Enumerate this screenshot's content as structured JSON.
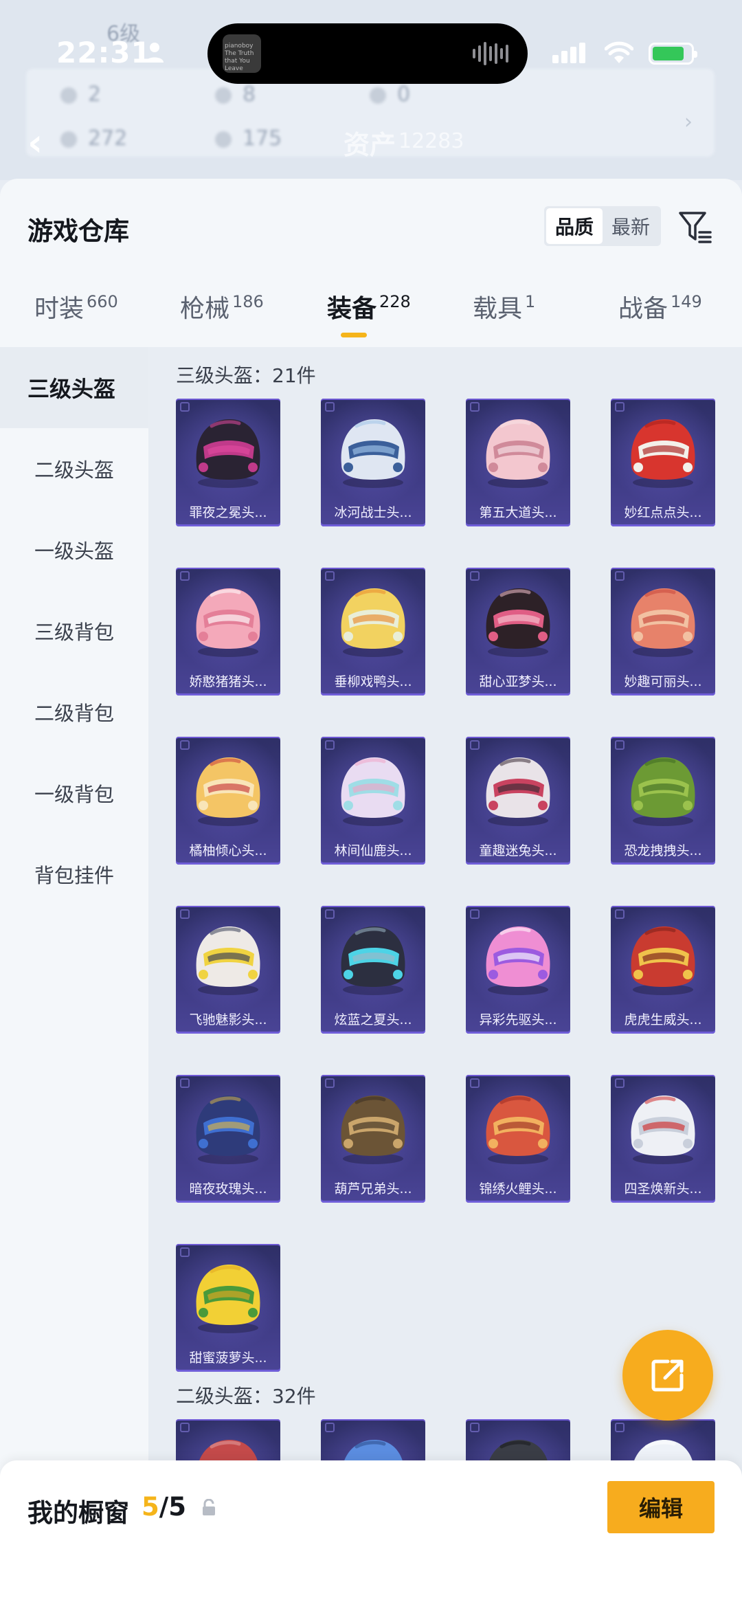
{
  "status_bar": {
    "time": "22:31",
    "island_thumb_text": "pianoboy The Truth that You Leave"
  },
  "background_header": {
    "level": "6级",
    "stats_row1": [
      "2",
      "8",
      "0"
    ],
    "stats_row2": [
      "272",
      "175"
    ],
    "asset_label": "资产",
    "asset_value": "12283"
  },
  "sheet": {
    "title": "游戏仓库",
    "sort_options": [
      "品质",
      "最新"
    ],
    "sort_selected": "品质"
  },
  "tabs": [
    {
      "label": "时装",
      "count": "660"
    },
    {
      "label": "枪械",
      "count": "186"
    },
    {
      "label": "装备",
      "count": "228",
      "active": true
    },
    {
      "label": "载具",
      "count": "1"
    },
    {
      "label": "战备",
      "count": "149"
    }
  ],
  "sidebar": {
    "items": [
      "三级头盔",
      "二级头盔",
      "一级头盔",
      "三级背包",
      "二级背包",
      "一级背包",
      "背包挂件"
    ],
    "active_index": 0
  },
  "sections": [
    {
      "title": "三级头盔：21件",
      "items": [
        {
          "name": "罪夜之冕头...",
          "palette": [
            "#2a2333",
            "#c03a8a",
            "#e04aa0"
          ]
        },
        {
          "name": "冰河战士头...",
          "palette": [
            "#dfe6f2",
            "#3b5f9a",
            "#9fc3e8"
          ]
        },
        {
          "name": "第五大道头...",
          "palette": [
            "#f3c7cf",
            "#d08a9a",
            "#f8e4e8"
          ]
        },
        {
          "name": "妙红点点头...",
          "palette": [
            "#d8352e",
            "#f3f0ea",
            "#a81f1c"
          ]
        },
        {
          "name": "娇憨猪猪头...",
          "palette": [
            "#f4a9ba",
            "#e47f98",
            "#ffffff"
          ]
        },
        {
          "name": "垂柳戏鸭头...",
          "palette": [
            "#f2d260",
            "#e9eed8",
            "#e98b2c"
          ]
        },
        {
          "name": "甜心亚梦头...",
          "palette": [
            "#2d2127",
            "#e05e85",
            "#f6c2d0"
          ]
        },
        {
          "name": "妙趣可丽头...",
          "palette": [
            "#e7826a",
            "#f2c1a2",
            "#c8473b"
          ]
        },
        {
          "name": "橘柚倾心头...",
          "palette": [
            "#f4c565",
            "#f9e5b8",
            "#c83a3a"
          ]
        },
        {
          "name": "林间仙鹿头...",
          "palette": [
            "#e9dcf2",
            "#9fdde6",
            "#f0a6c8"
          ]
        },
        {
          "name": "童趣迷兔头...",
          "palette": [
            "#e9e3e8",
            "#c94360",
            "#3b2b35"
          ]
        },
        {
          "name": "恐龙拽拽头...",
          "palette": [
            "#6c9a34",
            "#9bc24d",
            "#3f6b22"
          ]
        },
        {
          "name": "飞驰魅影头...",
          "palette": [
            "#eeeae6",
            "#f0d341",
            "#3b3f57"
          ]
        },
        {
          "name": "炫蓝之夏头...",
          "palette": [
            "#2c2f40",
            "#4dd3e6",
            "#9db7c7"
          ]
        },
        {
          "name": "异彩先驱头...",
          "palette": [
            "#ef8ed3",
            "#9c5be0",
            "#ffffff"
          ]
        },
        {
          "name": "虎虎生威头...",
          "palette": [
            "#c93b30",
            "#f0c24b",
            "#7a1f1a"
          ]
        },
        {
          "name": "暗夜玫瑰头...",
          "palette": [
            "#2e3b7a",
            "#3f6fd0",
            "#d6b24a"
          ]
        },
        {
          "name": "葫芦兄弟头...",
          "palette": [
            "#6b5436",
            "#caa56b",
            "#3a2e22"
          ]
        },
        {
          "name": "锦绣火鲤头...",
          "palette": [
            "#d9573f",
            "#f2b15f",
            "#9c2b22"
          ]
        },
        {
          "name": "四圣焕新头...",
          "palette": [
            "#eef0f5",
            "#c9cfdb",
            "#d12f2f"
          ]
        },
        {
          "name": "甜蜜菠萝头...",
          "palette": [
            "#f2d035",
            "#4a9a3a",
            "#e1a820"
          ]
        }
      ]
    },
    {
      "title": "二级头盔：32件",
      "items": [
        {
          "name": "",
          "palette": [
            "#c44a4a",
            "#2c2f40",
            "#e3a0a0"
          ]
        },
        {
          "name": "",
          "palette": [
            "#5b8de0",
            "#eef2f8",
            "#2b4c8a"
          ]
        },
        {
          "name": "",
          "palette": [
            "#3a3d46",
            "#d9dde6",
            "#18191e"
          ]
        },
        {
          "name": "",
          "palette": [
            "#eef2f8",
            "#b9c7de",
            "#ffffff"
          ]
        }
      ]
    }
  ],
  "showcase": {
    "label": "我的橱窗",
    "current": "5",
    "separator": "/",
    "max": "5"
  },
  "edit_label": "编辑",
  "colors": {
    "accent": "#f7ac1e",
    "card_bg": "#3d3a82",
    "sheet_bg": "#f4f7fa",
    "content_bg": "#e8edf3"
  }
}
